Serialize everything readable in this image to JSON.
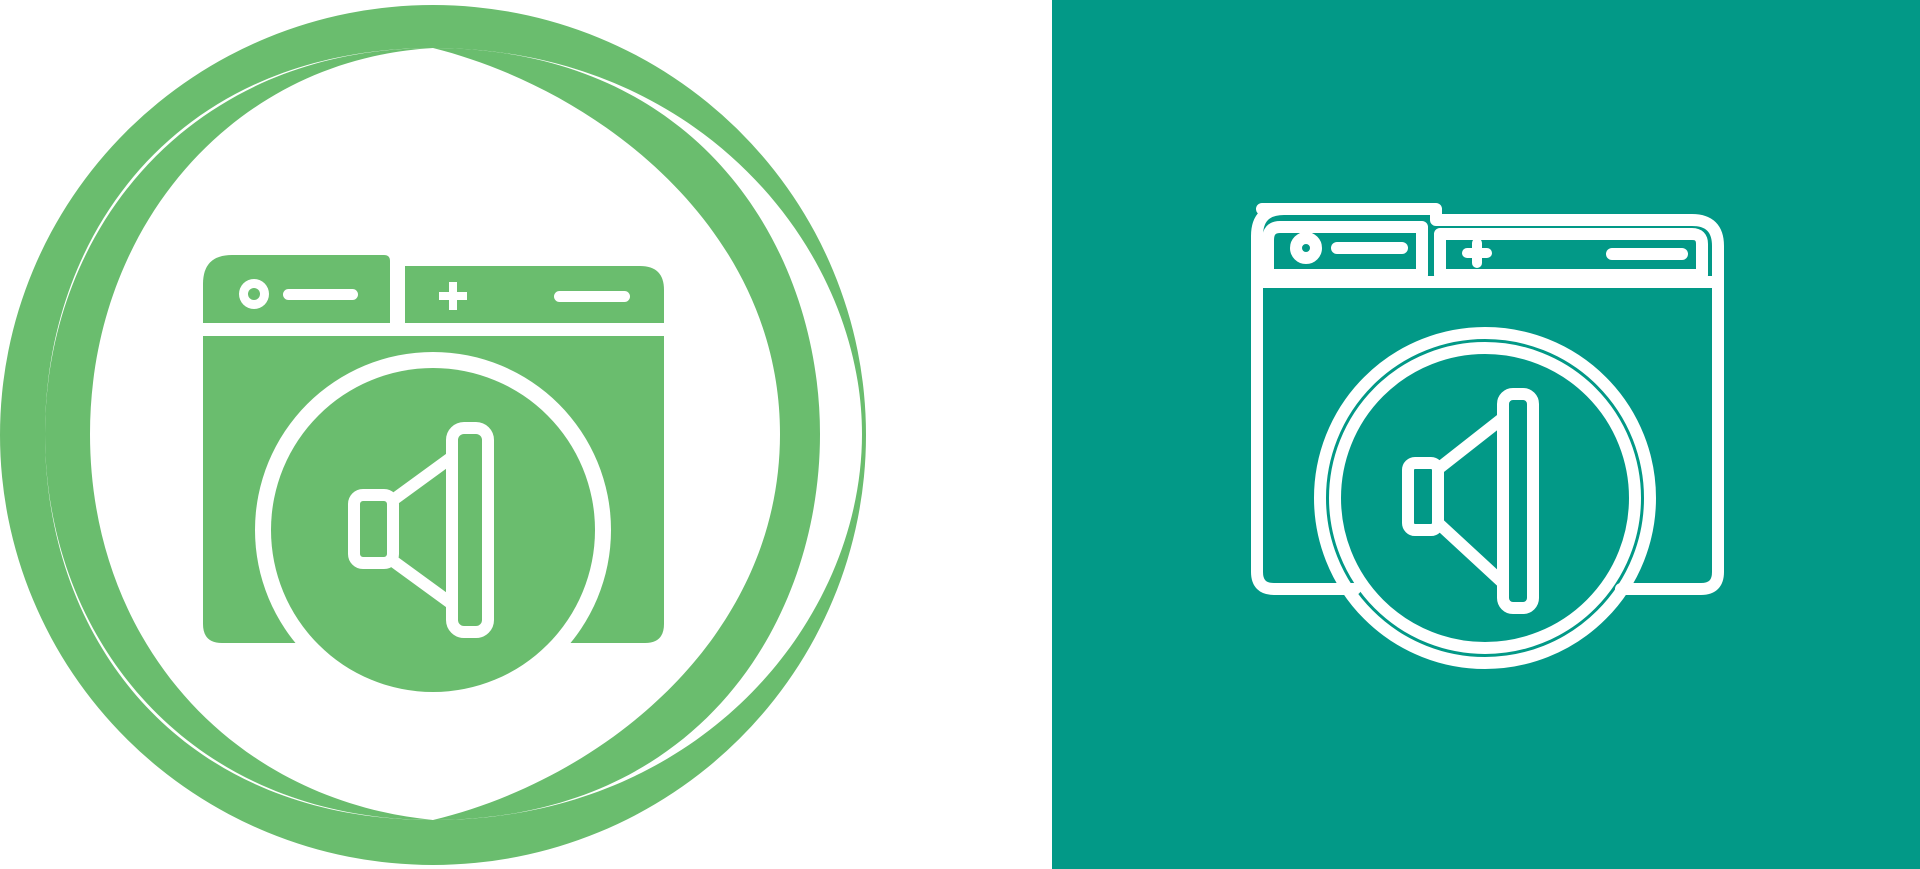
{
  "icons": [
    {
      "variant": "glyph-in-ring",
      "name": "browser-audio-icon",
      "colors": {
        "primary": "#6abd6e",
        "background": "#ffffff",
        "knockout": "#ffffff"
      }
    },
    {
      "variant": "outline-on-tile",
      "name": "browser-audio-icon",
      "colors": {
        "primary": "#ffffff",
        "background": "#029987"
      }
    }
  ]
}
